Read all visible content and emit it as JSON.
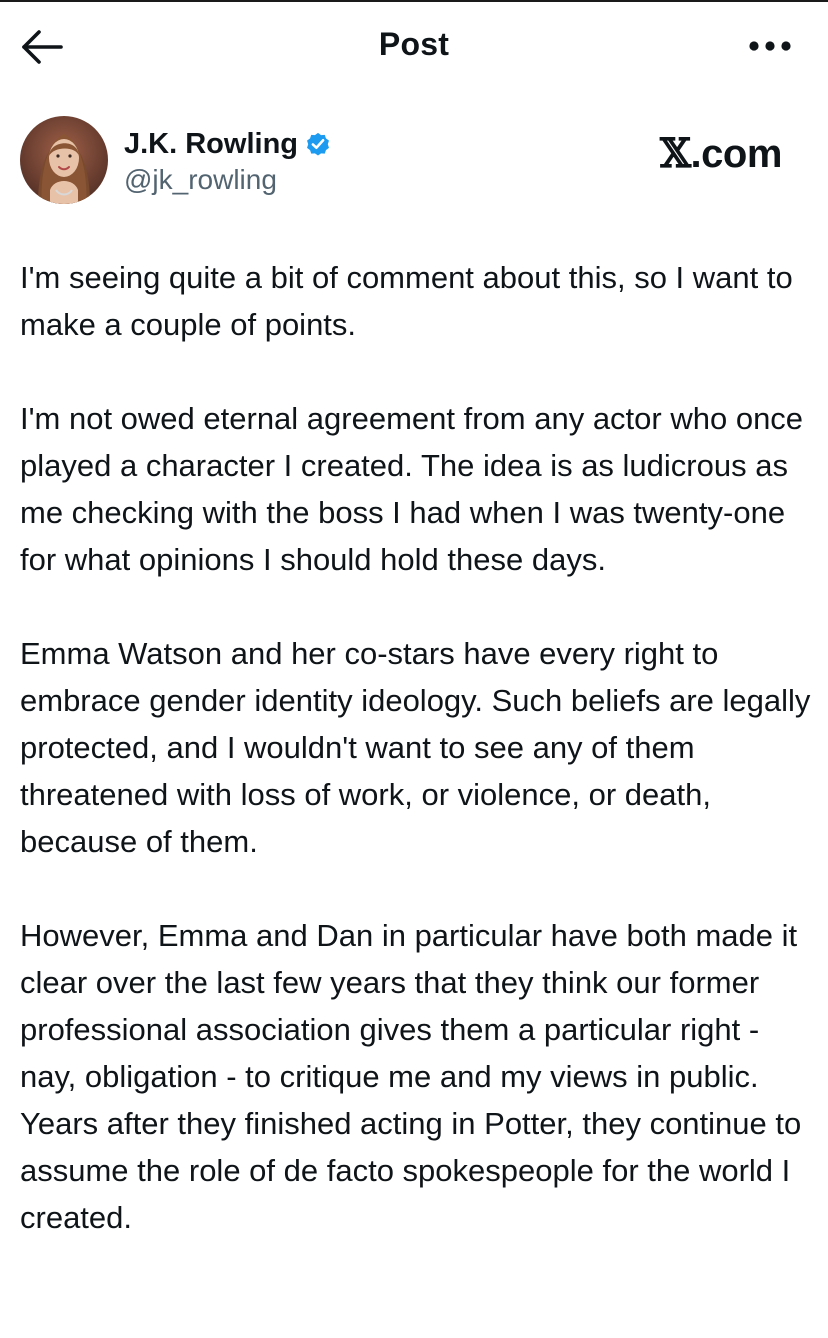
{
  "header": {
    "back_icon": "arrow-left-icon",
    "title": "Post",
    "more_icon": "more-horizontal-icon"
  },
  "author": {
    "name": "J.K. Rowling",
    "handle": "@jk_rowling",
    "verified_icon": "verified-badge-icon",
    "verified_color": "#1d9bf0"
  },
  "watermark": {
    "x_glyph": "𝕏",
    "suffix": ".com"
  },
  "post": {
    "paragraphs": [
      "I'm seeing quite a bit of comment about this, so I want to make a couple of points.",
      "I'm not owed eternal agreement from any actor who once played a character I created. The idea is as ludicrous as me checking with the boss I had when I was twenty-one for what opinions I should hold these days.",
      "Emma Watson and her co-stars have every right to embrace gender identity ideology. Such beliefs are legally protected, and I wouldn't want to see any of them threatened with loss of work, or violence, or death, because of them.",
      "However, Emma and Dan in particular have both made it clear over the last few years that they think our former professional association gives them a particular right - nay, obligation - to critique me and my views in public. Years after they finished acting in Potter, they continue to assume the role of de facto spokespeople for the world I created."
    ]
  },
  "colors": {
    "text": "#0f1419",
    "secondary_text": "#536471",
    "background": "#ffffff"
  }
}
